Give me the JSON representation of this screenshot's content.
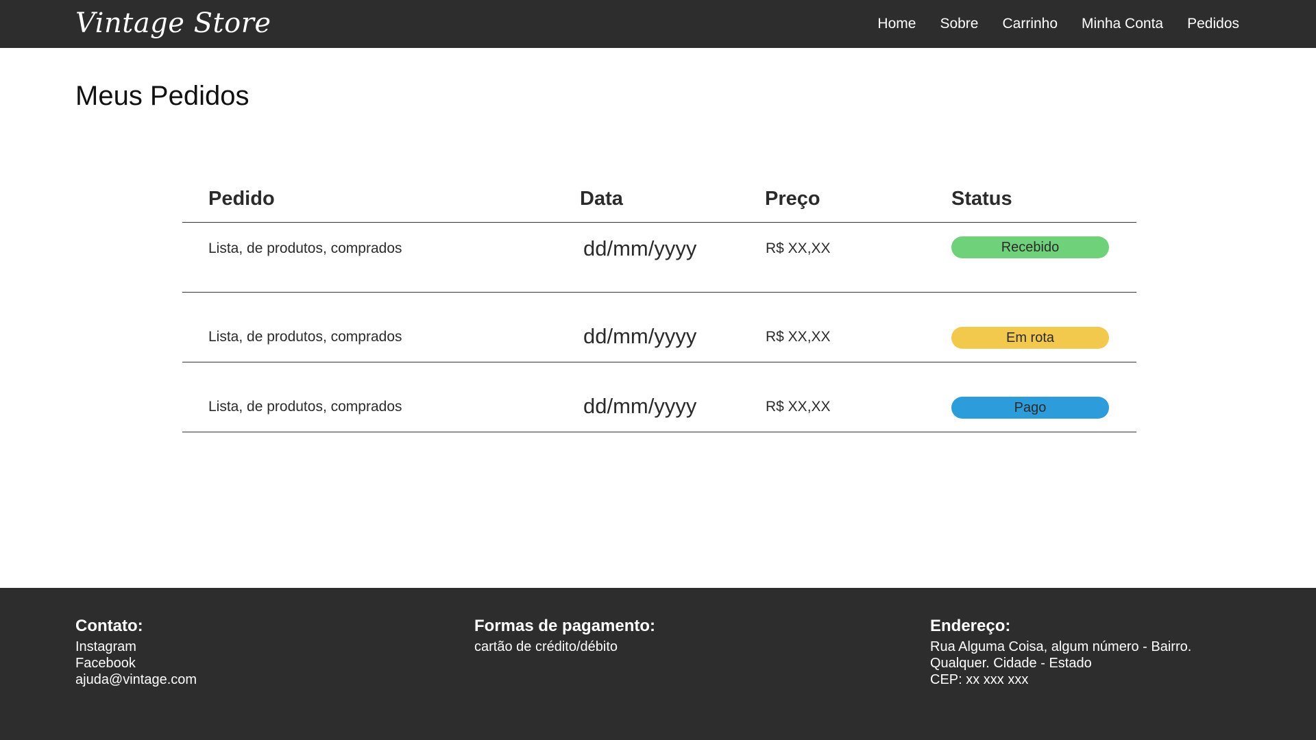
{
  "header": {
    "logo": "Vintage Store",
    "nav": [
      "Home",
      "Sobre",
      "Carrinho",
      "Minha Conta",
      "Pedidos"
    ]
  },
  "main": {
    "title": "Meus Pedidos",
    "table": {
      "columns": [
        "Pedido",
        "Data",
        "Preço",
        "Status"
      ],
      "rows": [
        {
          "pedido": "Lista, de produtos, comprados",
          "data": "dd/mm/yyyy",
          "preco": "R$ XX,XX",
          "status": "Recebido"
        },
        {
          "pedido": "Lista, de produtos, comprados",
          "data": "dd/mm/yyyy",
          "preco": "R$ XX,XX",
          "status": "Em rota"
        },
        {
          "pedido": "Lista, de produtos, comprados",
          "data": "dd/mm/yyyy",
          "preco": "R$ XX,XX",
          "status": "Pago"
        }
      ]
    },
    "status_colors": {
      "Recebido": "#6fd17a",
      "Em rota": "#f2c94c",
      "Pago": "#2d9cdb"
    }
  },
  "footer": {
    "contato": {
      "heading": "Contato:",
      "lines": [
        "Instagram",
        "Facebook",
        "ajuda@vintage.com"
      ]
    },
    "pagamento": {
      "heading": "Formas de pagamento:",
      "lines": [
        "cartão de crédito/débito"
      ]
    },
    "endereco": {
      "heading": "Endereço:",
      "lines": [
        "Rua Alguma Coisa, algum número - Bairro.",
        "Qualquer. Cidade - Estado",
        "CEP: xx xxx xxx"
      ]
    }
  }
}
